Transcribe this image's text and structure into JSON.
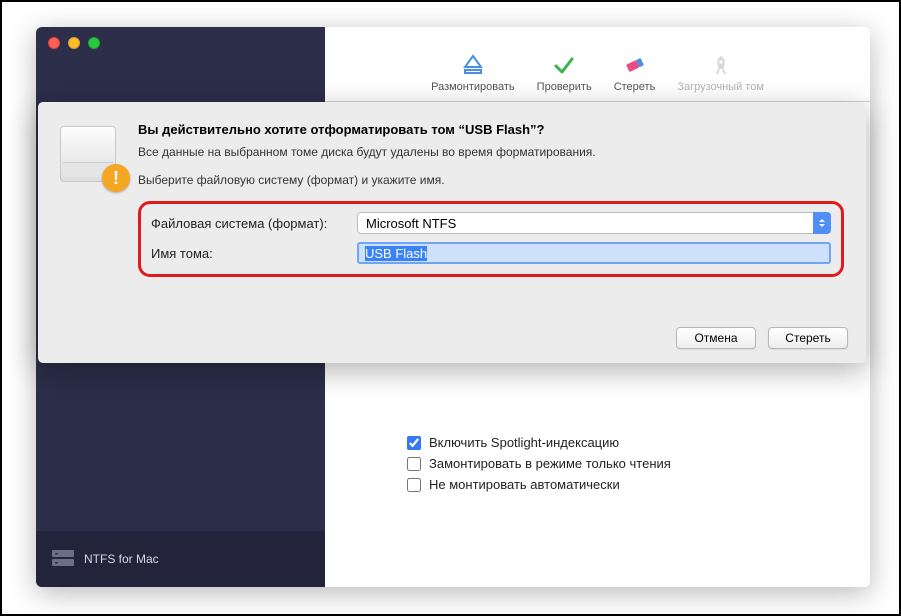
{
  "brand": {
    "name": "NTFS for Mac"
  },
  "toolbar": {
    "unmount": "Размонтировать",
    "verify": "Проверить",
    "erase": "Стереть",
    "startup": "Загрузочный том"
  },
  "options": {
    "spotlight": {
      "label": "Включить Spotlight-индексацию",
      "checked": true
    },
    "readonly": {
      "label": "Замонтировать в режиме только чтения",
      "checked": false
    },
    "noautomount": {
      "label": "Не монтировать автоматически",
      "checked": false
    }
  },
  "dialog": {
    "title": "Вы действительно хотите отформатировать том “USB Flash”?",
    "subtitle": "Все данные на выбранном томе диска будут удалены во время форматирования.",
    "instruction": "Выберите файловую систему (формат) и укажите имя.",
    "fs_label": "Файловая система (формат):",
    "fs_value": "Microsoft NTFS",
    "name_label": "Имя тома:",
    "name_value": "USB Flash",
    "cancel": "Отмена",
    "erase": "Стереть"
  }
}
